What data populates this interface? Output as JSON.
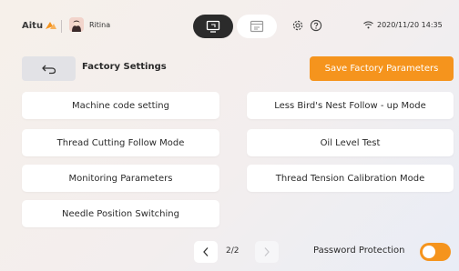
{
  "topbar": {
    "brand": "Aitu",
    "username": "Ritina",
    "datetime": "2020/11/20 14:35",
    "mode_icons": [
      "monitor-icon",
      "display-screen-icon"
    ],
    "settings_icon": "gear-icon",
    "help_icon": "help-icon",
    "wifi_icon": "wifi-icon"
  },
  "header": {
    "title": "Factory Settings",
    "back_icon": "back-arrow-icon",
    "save_label": "Save Factory Parameters"
  },
  "settings": {
    "left": [
      "Machine code setting",
      "Thread Cutting Follow Mode",
      "Monitoring Parameters",
      "Needle Position Switching"
    ],
    "right": [
      "Less Bird's Nest Follow - up Mode",
      "Oil Level Test",
      "Thread Tension Calibration Mode"
    ]
  },
  "pagination": {
    "indicator": "2/2",
    "current_page": 2,
    "total_pages": 2
  },
  "password_protection": {
    "label": "Password Protection",
    "enabled": true
  },
  "colors": {
    "accent": "#f5941d",
    "dark_button": "#2b2b2b",
    "card": "#ffffff"
  }
}
